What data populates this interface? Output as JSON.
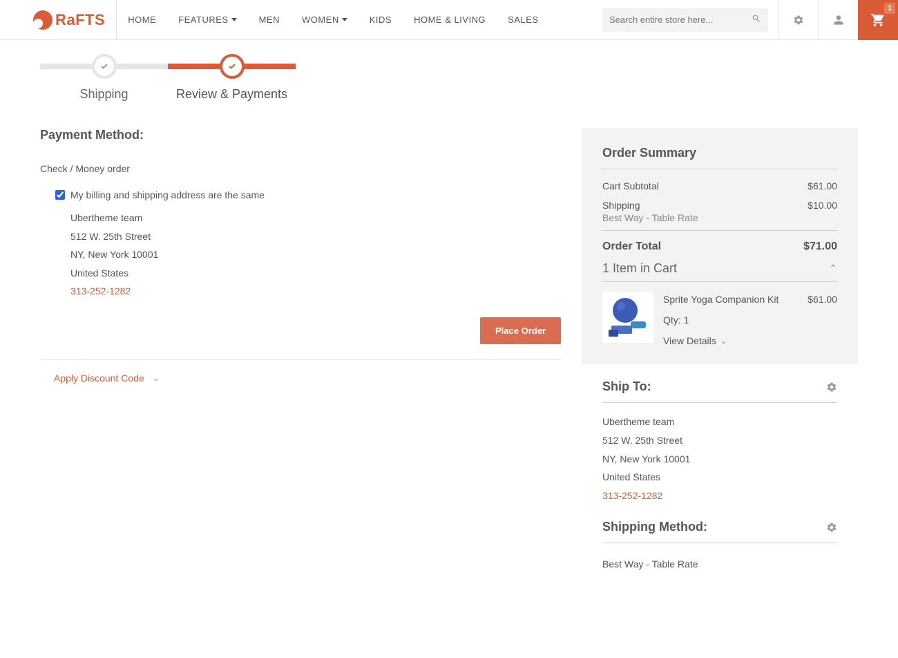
{
  "header": {
    "logo_text": "RaFTS",
    "nav": [
      "HOME",
      "FEATURES",
      "MEN",
      "WOMEN",
      "KIDS",
      "HOME & LIVING",
      "SALES"
    ],
    "search_placeholder": "Search entire store here...",
    "cart_count": "1"
  },
  "progress": {
    "step1": "Shipping",
    "step2": "Review & Payments"
  },
  "payment": {
    "title": "Payment Method:",
    "method": "Check / Money order",
    "same_address_label": "My billing and shipping address are the same",
    "addr_name": "Ubertheme team",
    "addr_street": "512 W. 25th Street",
    "addr_city": "NY, New York 10001",
    "addr_country": "United States",
    "addr_phone": "313-252-1282",
    "place_order": "Place Order",
    "discount": "Apply Discount Code"
  },
  "summary": {
    "title": "Order Summary",
    "subtotal_label": "Cart Subtotal",
    "subtotal": "$61.00",
    "shipping_label": "Shipping",
    "shipping": "$10.00",
    "shipping_detail": "Best Way - Table Rate",
    "total_label": "Order Total",
    "total": "$71.00",
    "items_label": "1 Item in Cart",
    "item_name": "Sprite Yoga Companion Kit",
    "item_price": "$61.00",
    "item_qty": "Qty: 1",
    "view_details": "View Details"
  },
  "shipto": {
    "title": "Ship To:",
    "name": "Ubertheme team",
    "street": "512 W. 25th Street",
    "city": "NY, New York 10001",
    "country": "United States",
    "phone": "313-252-1282"
  },
  "shipmethod": {
    "title": "Shipping Method:",
    "value": "Best Way - Table Rate"
  }
}
